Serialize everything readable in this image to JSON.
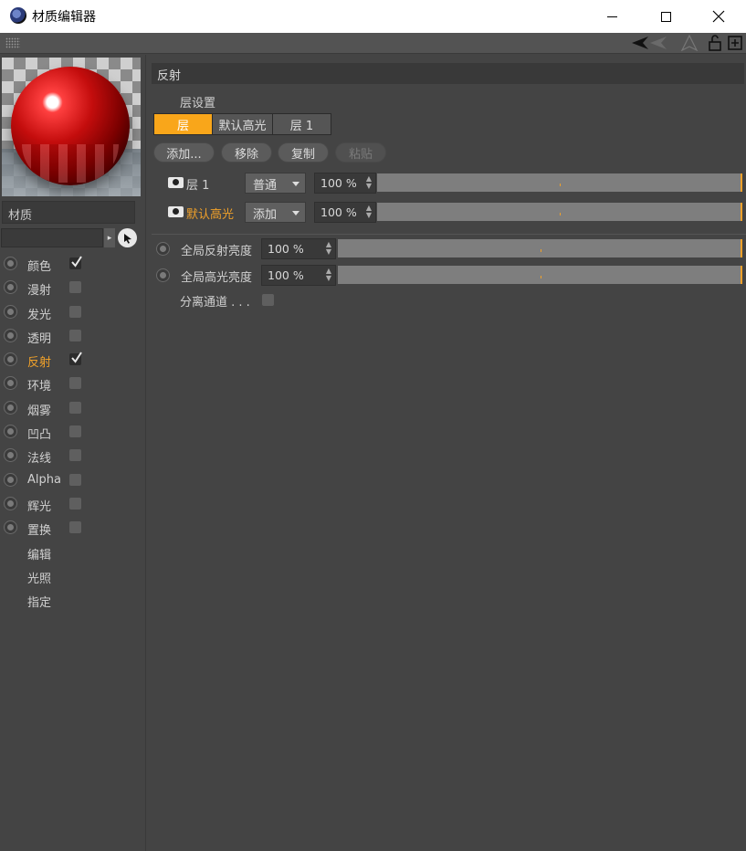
{
  "window": {
    "title": "材质编辑器"
  },
  "material": {
    "name": "材质"
  },
  "channels": [
    {
      "label": "颜色",
      "checked": true,
      "active": false
    },
    {
      "label": "漫射",
      "checked": false,
      "active": false
    },
    {
      "label": "发光",
      "checked": false,
      "active": false
    },
    {
      "label": "透明",
      "checked": false,
      "active": false
    },
    {
      "label": "反射",
      "checked": true,
      "active": true
    },
    {
      "label": "环境",
      "checked": false,
      "active": false
    },
    {
      "label": "烟雾",
      "checked": false,
      "active": false
    },
    {
      "label": "凹凸",
      "checked": false,
      "active": false
    },
    {
      "label": "法线",
      "checked": false,
      "active": false
    },
    {
      "label": "Alpha",
      "checked": false,
      "active": false
    },
    {
      "label": "辉光",
      "checked": false,
      "active": false
    },
    {
      "label": "置换",
      "checked": false,
      "active": false
    }
  ],
  "extras": [
    "编辑",
    "光照",
    "指定"
  ],
  "section": {
    "title": "反射",
    "layer_settings_label": "层设置",
    "tabs": [
      "层",
      "默认高光",
      "层 1"
    ],
    "buttons": {
      "add": "添加...",
      "remove": "移除",
      "copy": "复制",
      "paste": "粘贴"
    },
    "layers": [
      {
        "name": "层 1",
        "mode": "普通",
        "value": "100 %",
        "highlighted": false
      },
      {
        "name": "默认高光",
        "mode": "添加",
        "value": "100 %",
        "highlighted": true
      }
    ],
    "global": [
      {
        "label": "全局反射亮度",
        "value": "100 %"
      },
      {
        "label": "全局高光亮度",
        "value": "100 %"
      }
    ],
    "separate_channels": "分离通道 . . ."
  },
  "colors": {
    "accent": "#f9a61a",
    "background": "#444444",
    "highlight_text": "#f0a12a"
  }
}
